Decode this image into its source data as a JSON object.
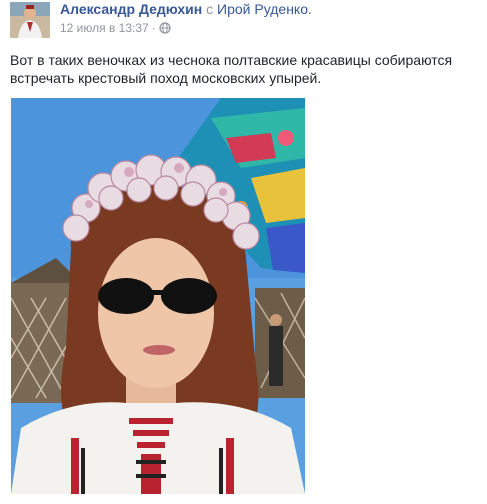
{
  "post": {
    "author": "Александр Дедюхин",
    "with_text": "с",
    "tagged_user": "Ирой Руденко.",
    "date": "12 июля в 13:37",
    "separator": "·",
    "audience_icon": "globe-icon",
    "text": "Вот в таких веночках из чеснока полтавские красавицы собираются встречать крестовый поход московских упырей."
  },
  "colors": {
    "link": "#365899",
    "meta": "#90949c",
    "body_text": "#1d2129",
    "sky": "#5aa0e0"
  }
}
